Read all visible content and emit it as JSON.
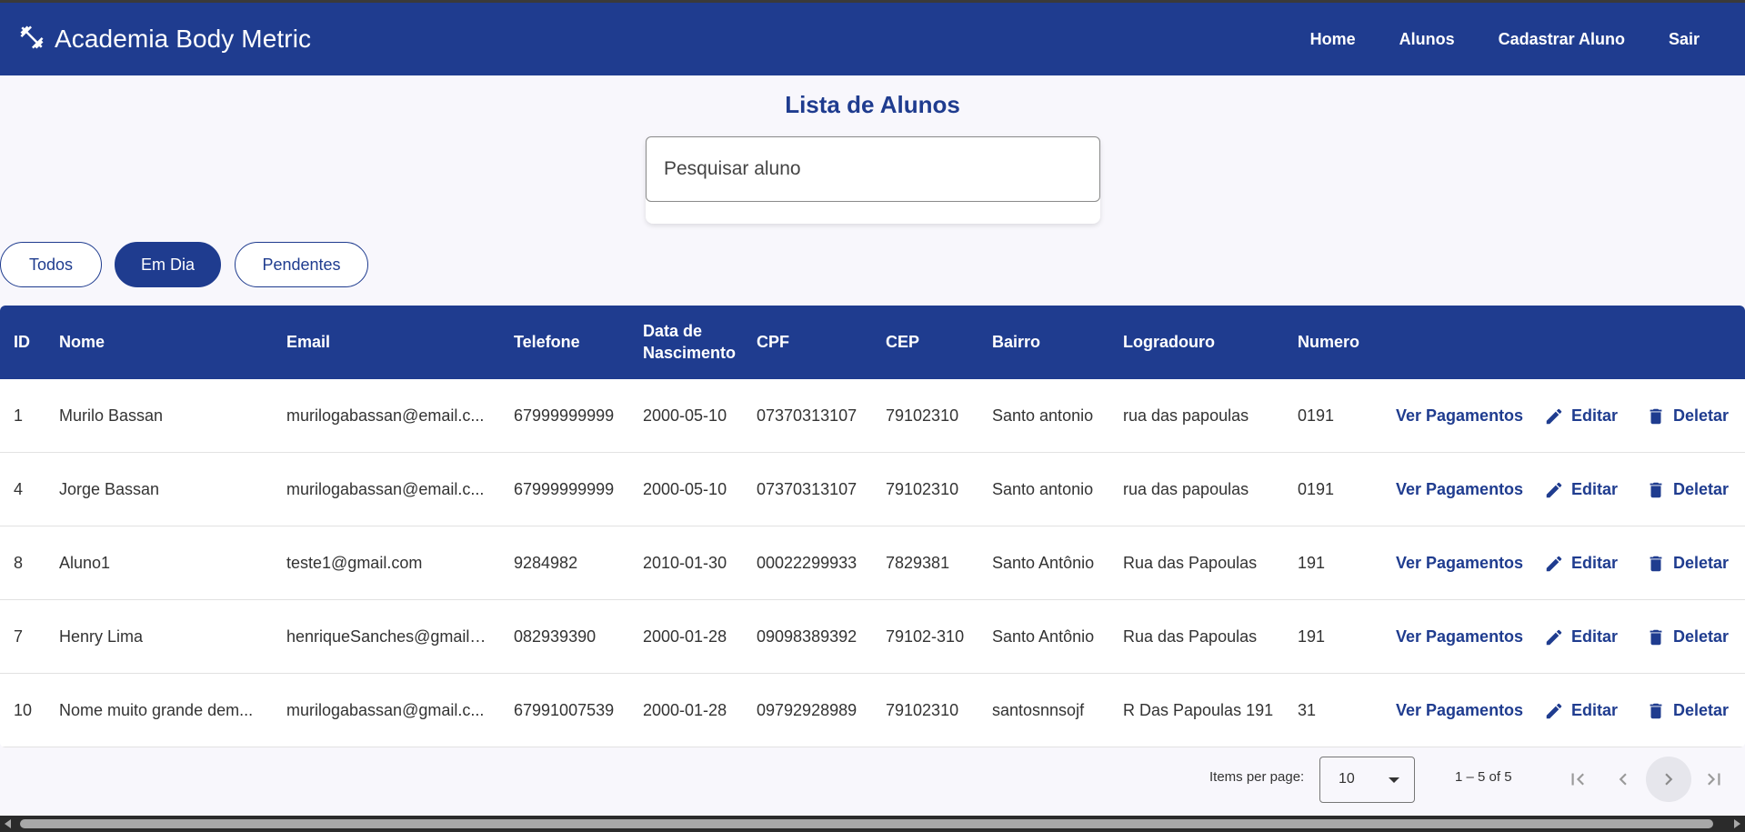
{
  "app": {
    "title": "Academia Body Metric",
    "icon": "dumbbell-icon"
  },
  "nav": {
    "items": [
      "Home",
      "Alunos",
      "Cadastrar Aluno",
      "Sair"
    ]
  },
  "page": {
    "title": "Lista de Alunos"
  },
  "search": {
    "placeholder": "Pesquisar aluno",
    "value": ""
  },
  "filters": {
    "items": [
      "Todos",
      "Em Dia",
      "Pendentes"
    ],
    "active": "Em Dia"
  },
  "table": {
    "headers": [
      "ID",
      "Nome",
      "Email",
      "Telefone",
      "Data de Nascimento",
      "CPF",
      "CEP",
      "Bairro",
      "Logradouro",
      "Numero"
    ],
    "rows": [
      {
        "id": "1",
        "nome": "Murilo Bassan",
        "email": "murilogabassan@email.c...",
        "telefone": "67999999999",
        "nascimento": "2000-05-10",
        "cpf": "07370313107",
        "cep": "79102310",
        "bairro": "Santo antonio",
        "logradouro": "rua das papoulas",
        "numero": "0191"
      },
      {
        "id": "4",
        "nome": "Jorge Bassan",
        "email": "murilogabassan@email.c...",
        "telefone": "67999999999",
        "nascimento": "2000-05-10",
        "cpf": "07370313107",
        "cep": "79102310",
        "bairro": "Santo antonio",
        "logradouro": "rua das papoulas",
        "numero": "0191"
      },
      {
        "id": "8",
        "nome": "Aluno1",
        "email": "teste1@gmail.com",
        "telefone": "9284982",
        "nascimento": "2010-01-30",
        "cpf": "00022299933",
        "cep": "7829381",
        "bairro": "Santo Antônio",
        "logradouro": "Rua das Papoulas",
        "numero": "191"
      },
      {
        "id": "7",
        "nome": "Henry Lima",
        "email": "henriqueSanches@gmail....",
        "telefone": "082939390",
        "nascimento": "2000-01-28",
        "cpf": "09098389392",
        "cep": "79102-310",
        "bairro": "Santo Antônio",
        "logradouro": "Rua das Papoulas",
        "numero": "191"
      },
      {
        "id": "10",
        "nome": "Nome muito grande dem...",
        "email": "murilogabassan@gmail.c...",
        "telefone": "67991007539",
        "nascimento": "2000-01-28",
        "cpf": "09792928989",
        "cep": "79102310",
        "bairro": "santosnnsojf",
        "logradouro": "R Das Papoulas 191",
        "numero": "31"
      }
    ],
    "actions": {
      "payments": "Ver Pagamentos",
      "edit": "Editar",
      "delete": "Deletar"
    }
  },
  "paginator": {
    "items_per_page_label": "Items per page:",
    "page_size": "10",
    "range": "1 – 5 of 5"
  },
  "colors": {
    "primary": "#1f3c8f",
    "background": "#f8f7fc"
  }
}
